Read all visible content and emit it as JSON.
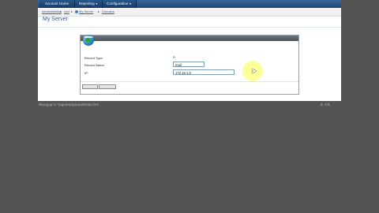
{
  "nav": {
    "items": [
      {
        "label": "Account Home",
        "arrow": ""
      },
      {
        "label": "Reporting",
        "arrow": "▼"
      },
      {
        "label": "Configuration",
        "arrow": "▼"
      }
    ]
  },
  "breadcrumb": {
    "items": [
      "administration",
      "root",
      "My Server",
      "Domains"
    ],
    "separator": "▸"
  },
  "page": {
    "title": "My Server"
  },
  "dialog": {
    "title": "",
    "fields": [
      {
        "label": "Record Type:",
        "value": "A"
      },
      {
        "label": "Record Name:",
        "value": "mail"
      },
      {
        "label": "IP:",
        "value": "172.16.1.5"
      }
    ],
    "buttons": [
      "",
      ""
    ]
  },
  "status": {
    "left": "Wuugyp-1-7pguanp/pniuutbxtsu.frm",
    "right": "8: 1/9"
  },
  "colors": {
    "nav_bg": "#1f4775",
    "page_bg": "#ffffff",
    "screen_bg": "#545454",
    "title": "#2f5d8e",
    "highlight": "#ffff78"
  }
}
